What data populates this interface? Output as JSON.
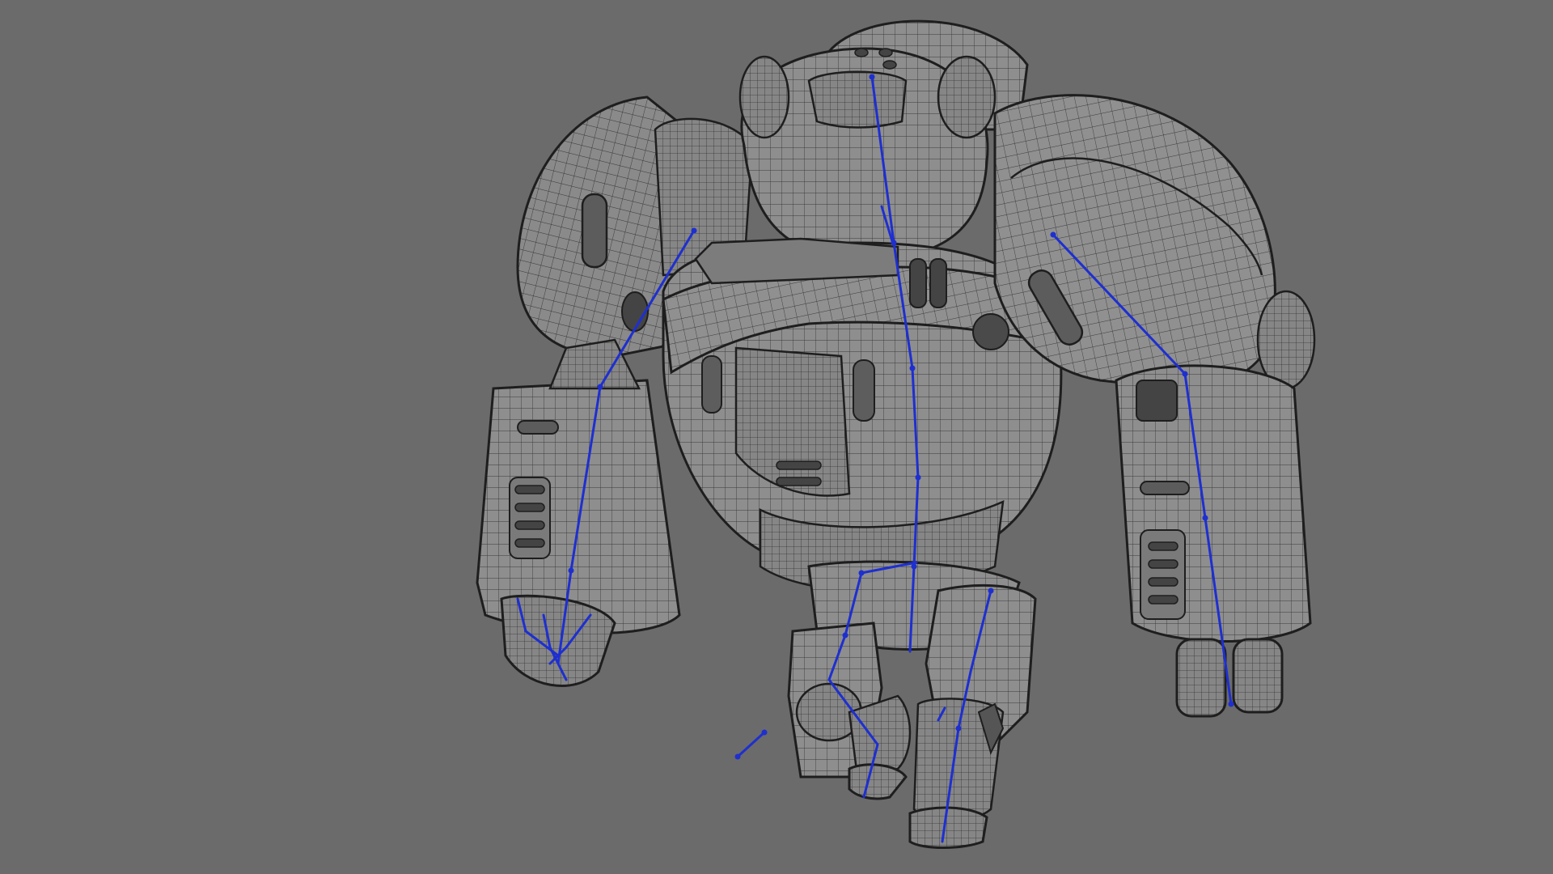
{
  "viewport": {
    "background_color": "#6b6b6b",
    "mesh_fill_color": "#8c8c8c",
    "mesh_shade_color": "#7a7a7a",
    "wire_color": "#2e2e2e",
    "outline_color": "#1e1e1e",
    "bone_color": "#1e2fd0"
  },
  "subject": {
    "name": "robot-wireframe-model",
    "parts": [
      "head",
      "torso",
      "left-shoulder-pad",
      "right-shoulder-pad",
      "left-forearm",
      "right-forearm",
      "left-hand",
      "right-exhaust-pipes",
      "pelvis",
      "left-leg",
      "right-leg",
      "left-foot",
      "right-foot"
    ]
  }
}
